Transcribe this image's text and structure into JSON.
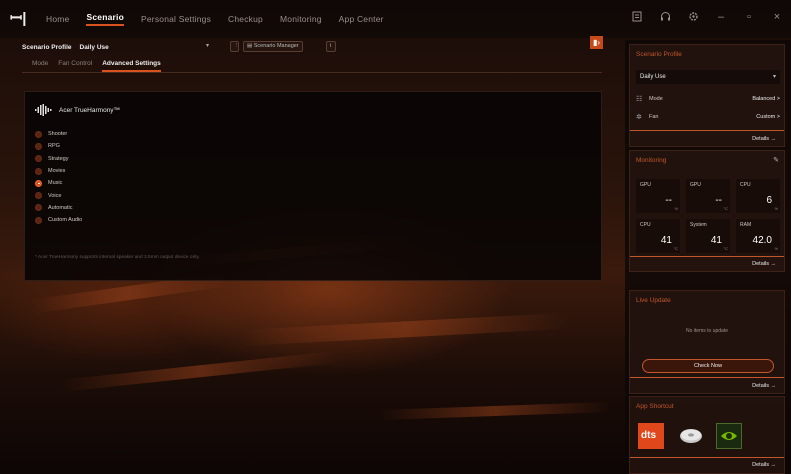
{
  "nav": {
    "items": [
      {
        "label": "Home",
        "active": false
      },
      {
        "label": "Scenario",
        "active": true
      },
      {
        "label": "Personal Settings",
        "active": false
      },
      {
        "label": "Checkup",
        "active": false
      },
      {
        "label": "Monitoring",
        "active": false
      },
      {
        "label": "App Center",
        "active": false
      }
    ],
    "icons": [
      "notes-icon",
      "headset-icon",
      "settings-icon",
      "minimize-icon",
      "maximize-icon",
      "close-icon"
    ],
    "glyphs": {
      "logo": "ꟷ|",
      "minimize": "–",
      "maximize": "▫",
      "close": "×"
    }
  },
  "profile_row": {
    "label": "Scenario Profile",
    "value": "Daily Use",
    "manager_label": "Scenario Manager"
  },
  "subtabs": [
    {
      "label": "Mode",
      "active": false
    },
    {
      "label": "Fan Control",
      "active": false
    },
    {
      "label": "Advanced Settings",
      "active": true
    }
  ],
  "panel": {
    "title": "Acer TrueHarmony™",
    "modes": [
      {
        "label": "Shooter",
        "selected": false
      },
      {
        "label": "RPG",
        "selected": false
      },
      {
        "label": "Strategy",
        "selected": false
      },
      {
        "label": "Movies",
        "selected": false
      },
      {
        "label": "Music",
        "selected": true
      },
      {
        "label": "Voice",
        "selected": false
      },
      {
        "label": "Automatic",
        "selected": false
      },
      {
        "label": "Custom Audio",
        "selected": false
      }
    ],
    "note": "* Acer TrueHarmony supports internal speaker and 3.5mm output device only."
  },
  "sidebar": {
    "scenario": {
      "title": "Scenario Profile",
      "selected": "Daily Use",
      "mode_label": "Mode",
      "mode_value": "Balanced >",
      "fan_label": "Fan",
      "fan_value": "Custom >",
      "details": "Details →"
    },
    "monitoring": {
      "title": "Monitoring",
      "boxes": [
        {
          "label": "GPU",
          "value": "--",
          "unit": "%"
        },
        {
          "label": "GPU",
          "value": "--",
          "unit": "°C"
        },
        {
          "label": "CPU",
          "value": "6",
          "unit": "%"
        },
        {
          "label": "CPU",
          "value": "41",
          "unit": "°C"
        },
        {
          "label": "System",
          "value": "41",
          "unit": "°C"
        },
        {
          "label": "RAM",
          "value": "42.0",
          "unit": "%"
        }
      ],
      "details": "Details →"
    },
    "live_update": {
      "title": "Live Update",
      "message": "No items to update",
      "button": "Check Now",
      "details": "Details →"
    },
    "app_shortcut": {
      "title": "App Shortcut",
      "apps": [
        "dts-app",
        "disc-app",
        "nvidia-app"
      ],
      "dts_text": "dts",
      "details": "Details →"
    }
  },
  "colors": {
    "accent": "#d9531e",
    "card_title": "#c0562a"
  }
}
